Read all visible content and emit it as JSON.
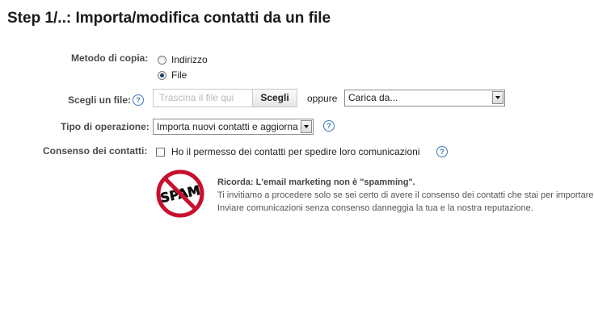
{
  "page_title": "Step 1/..: Importa/modifica contatti da un file",
  "form": {
    "copy_method": {
      "label": "Metodo di copia:",
      "options": [
        "Indirizzo",
        "File"
      ],
      "selected": "File"
    },
    "choose_file": {
      "label": "Scegli un file:",
      "placeholder": "Trascina il file qui",
      "button": "Scegli",
      "or_text": "oppure",
      "upload_from_value": "Carica da..."
    },
    "operation_type": {
      "label": "Tipo di operazione:",
      "value": "Importa nuovi contatti e aggiorna"
    },
    "consent": {
      "label": "Consenso dei contatti:",
      "checkbox_label": "Ho il permesso dei contatti per spedire loro comunicazioni",
      "checked": false
    },
    "help_icon_text": "?"
  },
  "notice": {
    "badge_text": "SPAM",
    "heading": "Ricorda: L'email marketing non è \"spamming\".",
    "line1": "Ti invitiamo a procedere solo se sei certo di avere il consenso dei contatti che stai per importare.",
    "line2": "Inviare comunicazioni senza consenso danneggia la tua e la nostra reputazione."
  },
  "colors": {
    "help_icon": "#3b78b5",
    "no_spam_ring": "#c8102e"
  }
}
